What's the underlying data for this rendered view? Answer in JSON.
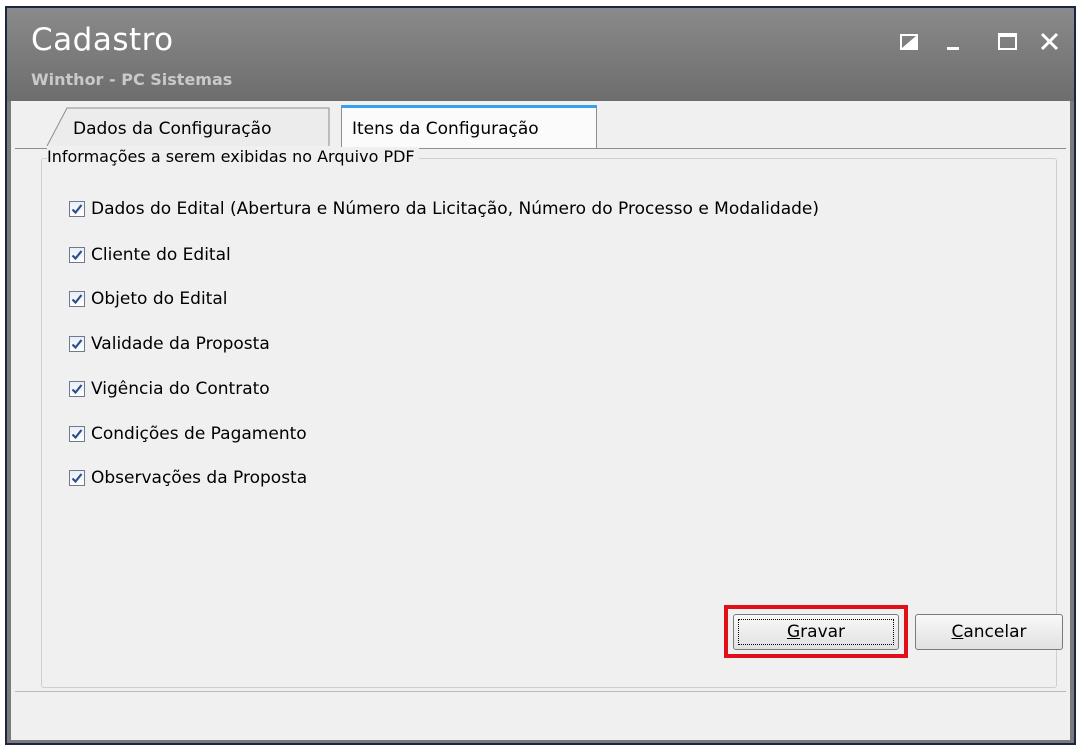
{
  "window": {
    "title": "Cadastro",
    "subtitle": "Winthor - PC Sistemas",
    "controls": [
      "restore-icon",
      "minimize-icon",
      "maximize-icon",
      "close-icon"
    ]
  },
  "tabs": [
    {
      "label": "Dados da Configuração",
      "active": false
    },
    {
      "label": "Itens da Configuração",
      "active": true
    }
  ],
  "group": {
    "legend": "Informações a serem exibidas no Arquivo PDF",
    "items": [
      {
        "label": "Dados do Edital (Abertura e Número da Licitação, Número do Processo e Modalidade)",
        "checked": true
      },
      {
        "label": "Cliente do Edital",
        "checked": true
      },
      {
        "label": "Objeto do Edital",
        "checked": true
      },
      {
        "label": "Validade da Proposta",
        "checked": true
      },
      {
        "label": "Vigência do Contrato",
        "checked": true
      },
      {
        "label": "Condições de Pagamento",
        "checked": true
      },
      {
        "label": "Observações da Proposta",
        "checked": true
      }
    ]
  },
  "buttons": {
    "gravar_mnemonic": "G",
    "gravar_rest": "ravar",
    "cancelar_mnemonic": "C",
    "cancelar_rest": "ancelar"
  },
  "colors": {
    "title_bar": "#7a7a7a",
    "active_tab_accent": "#3aa0ea",
    "highlight": "#e0101a",
    "check": "#2b4f8c"
  }
}
